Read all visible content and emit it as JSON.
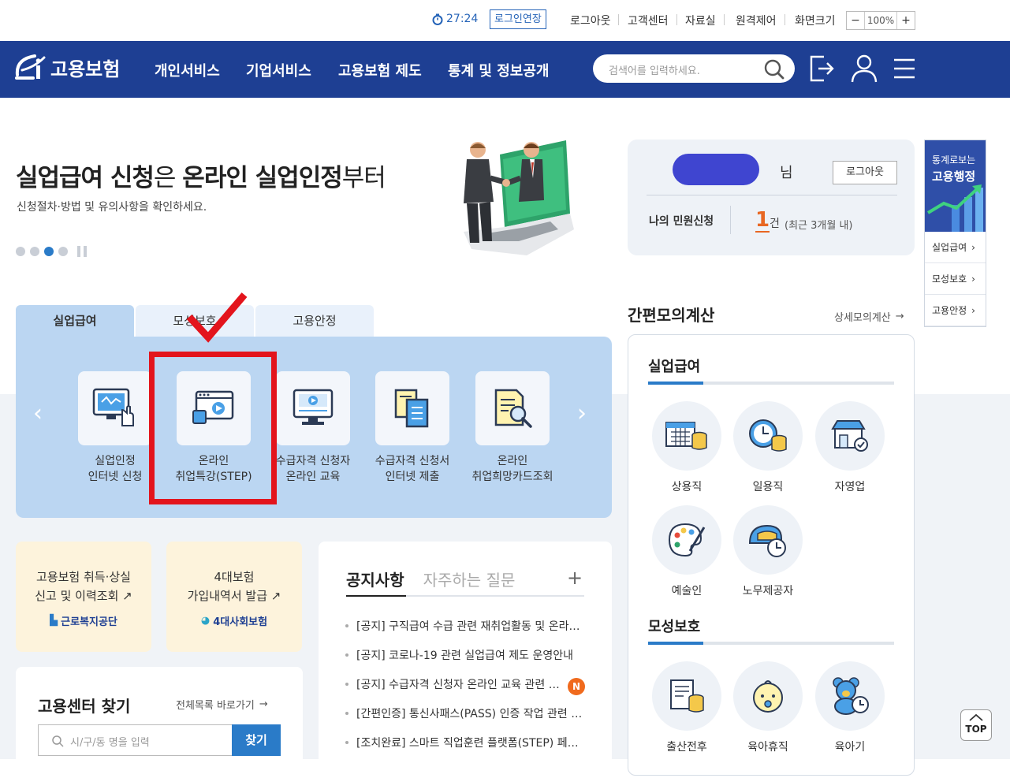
{
  "topbar": {
    "timer": "27:24",
    "extend_login": "로그인연장",
    "logout": "로그아웃",
    "customer_center": "고객센터",
    "archive": "자료실",
    "remote_support": "원격제어",
    "screen_size": "화면크기",
    "zoom_minus": "−",
    "zoom_value": "100%",
    "zoom_plus": "+"
  },
  "nav": {
    "logo_text": "고용보험",
    "menu": [
      "개인서비스",
      "기업서비스",
      "고용보험 제도",
      "통계 및 정보공개"
    ],
    "search_placeholder": "검색어를 입력하세요."
  },
  "hero": {
    "title_bold1": "실업급여 신청",
    "title_light1": "은 ",
    "title_bold2": "온라인 실업인정",
    "title_light2": "부터",
    "subtitle": "신청절차·방법 및 유의사항을 확인하세요."
  },
  "user": {
    "suffix": "님",
    "logout_button": "로그아웃",
    "requests_label": "나의 민원신청",
    "requests_count": "1",
    "requests_unit": "건",
    "requests_note": "(최근 3개월 내)"
  },
  "side_panel": {
    "line1": "통계로보는",
    "line2": "고용행정",
    "links": [
      "실업급여",
      "모성보호",
      "고용안정"
    ]
  },
  "tabs": [
    "실업급여",
    "모성보호",
    "고용안정"
  ],
  "services": [
    {
      "line1": "실업인정",
      "line2": "인터넷 신청"
    },
    {
      "line1": "온라인",
      "line2": "취업특강(STEP)"
    },
    {
      "line1": "수급자격 신청자",
      "line2": "온라인 교육"
    },
    {
      "line1": "수급자격 신청서",
      "line2": "인터넷 제출"
    },
    {
      "line1": "온라인",
      "line2": "취업희망카드조회"
    }
  ],
  "calc": {
    "title": "간편모의계산",
    "more": "상세모의계산",
    "cat1": "실업급여",
    "cat1_items": [
      "상용직",
      "일용직",
      "자영업",
      "예술인",
      "노무제공자"
    ],
    "cat2": "모성보호",
    "cat2_items": [
      "출산전후",
      "육아휴직",
      "육아기"
    ]
  },
  "quick": [
    {
      "line1": "고용보험 취득·상실",
      "line2": "신고 및 이력조회",
      "org": "근로복지공단"
    },
    {
      "line1": "4대보험",
      "line2": "가입내역서 발급",
      "org": "4대사회보험"
    }
  ],
  "center": {
    "title": "고용센터 찾기",
    "more": "전체목록 바로가기",
    "placeholder": "시/구/동 명을 입력",
    "button": "찾기"
  },
  "notice": {
    "tab_on": "공지사항",
    "tab_off": "자주하는 질문",
    "plus": "+",
    "new_badge": "N",
    "items": [
      "[공지] 구직급여 수급 관련 재취업활동 및 온라인 실업인정 안내",
      "[공지] 코로나-19 관련 실업급여 제도 운영안내",
      "[공지] 수급자격 신청자 온라인 교육 관련 안내",
      "[간편인증] 통신사패스(PASS) 인증 작업 관련 안내",
      "[조치완료] 스마트 직업훈련 플랫폼(STEP) 페이지 접속 장애"
    ]
  },
  "top_button": "TOP"
}
